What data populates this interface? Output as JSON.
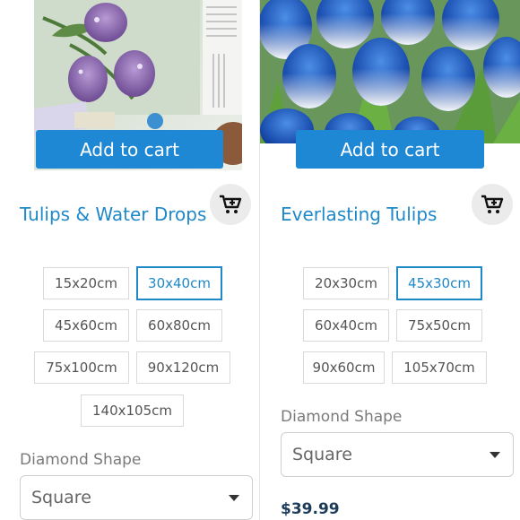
{
  "products": [
    {
      "name": "Tulips & Water Drops",
      "add_to_cart": "Add to cart",
      "sizes": [
        "15x20cm",
        "30x40cm",
        "45x60cm",
        "60x80cm",
        "75x100cm",
        "90x120cm",
        "140x105cm"
      ],
      "selected_size": "30x40cm",
      "option_label": "Diamond Shape",
      "option_value": "Square",
      "image_icon": "purple-tulips-image"
    },
    {
      "name": "Everlasting Tulips",
      "add_to_cart": "Add to cart",
      "sizes": [
        "20x30cm",
        "45x30cm",
        "60x40cm",
        "75x50cm",
        "90x60cm",
        "105x70cm"
      ],
      "selected_size": "45x30cm",
      "option_label": "Diamond Shape",
      "option_value": "Square",
      "price": "$39.99",
      "image_icon": "blue-tulips-image"
    }
  ],
  "colors": {
    "accent": "#1f88d4",
    "title": "#1f88c8",
    "price": "#1d3c5a"
  },
  "icons": {
    "cart": "add-to-cart-icon",
    "dropdown": "chevron-down-icon"
  }
}
